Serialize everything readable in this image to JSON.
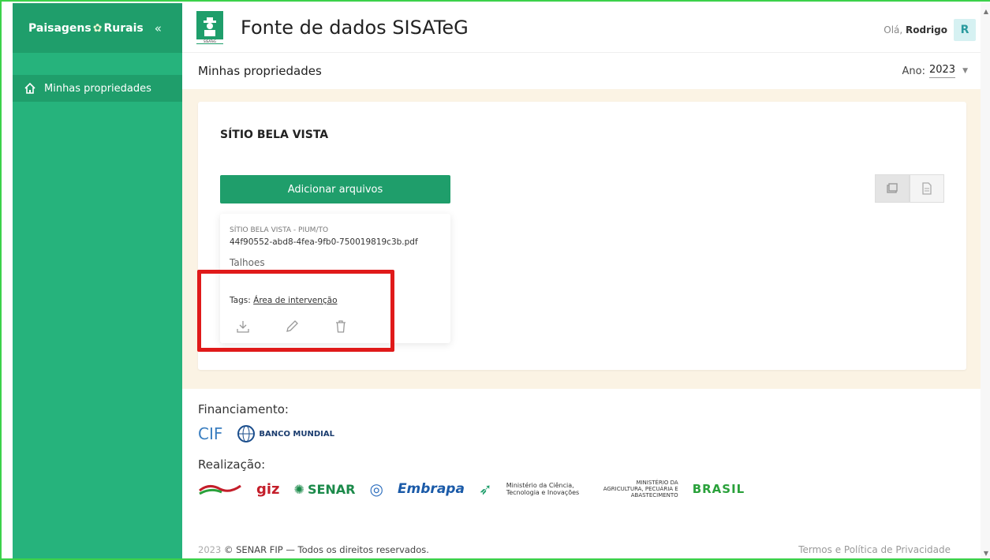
{
  "sidebar": {
    "brand_left": "Paisagens",
    "brand_right": "Rurais",
    "collapse_icon": "«",
    "items": [
      {
        "label": "Minhas propriedades",
        "icon": "home-icon"
      }
    ]
  },
  "header": {
    "app_icon_caption": "SISATeG",
    "title": "Fonte de dados SISATeG",
    "greeting": "Olá,",
    "user_name": "Rodrigo",
    "avatar_letter": "R"
  },
  "subbar": {
    "title": "Minhas propriedades",
    "year_label": "Ano:",
    "year_value": "2023"
  },
  "property": {
    "name": "SÍTIO BELA VISTA",
    "add_button": "Adicionar arquivos",
    "file": {
      "subtitle": "SÍTIO BELA VISTA - PIUM/TO",
      "filename": "44f90552-abd8-4fea-9fb0-750019819c3b.pdf",
      "type": "Talhoes",
      "tags_label": "Tags:",
      "tag": "Área de intervenção"
    }
  },
  "footer": {
    "financiamento": "Financiamento:",
    "realizacao": "Realização:",
    "funders": [
      "CIF",
      "BANCO MUNDIAL"
    ],
    "partners": [
      "giz",
      "SENAR",
      "Embrapa",
      "Ministério da Ciência, Tecnologia e Inovações",
      "MINISTÉRIO DA AGRICULTURA, PECUÁRIA E ABASTECIMENTO",
      "BRASIL"
    ],
    "year": "2023",
    "copyright": "© SENAR FIP — Todos os direitos reservados.",
    "terms": "Termos e Política de Privacidade"
  },
  "colors": {
    "primary": "#1f9e6b",
    "sidebar": "#26b37c",
    "highlight": "#e01a1a",
    "content_bg": "#fbf3e4"
  }
}
